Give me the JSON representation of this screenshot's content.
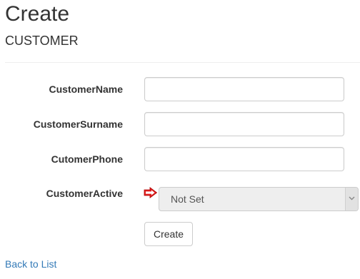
{
  "page": {
    "title": "Create",
    "subtitle": "CUSTOMER"
  },
  "form": {
    "fields": [
      {
        "label": "CustomerName",
        "value": ""
      },
      {
        "label": "CustomerSurname",
        "value": ""
      },
      {
        "label": "CutomerPhone",
        "value": ""
      }
    ],
    "active": {
      "label": "CustomerActive",
      "selected": "Not Set"
    },
    "submit_label": "Create"
  },
  "footer": {
    "back_link": "Back to List"
  },
  "icons": {
    "pointer": "red-arrow-icon",
    "dropdown": "chevron-down-icon"
  },
  "colors": {
    "link": "#337ab7",
    "pointer_arrow": "#e02020",
    "disabled_select": "#eeeeee"
  }
}
